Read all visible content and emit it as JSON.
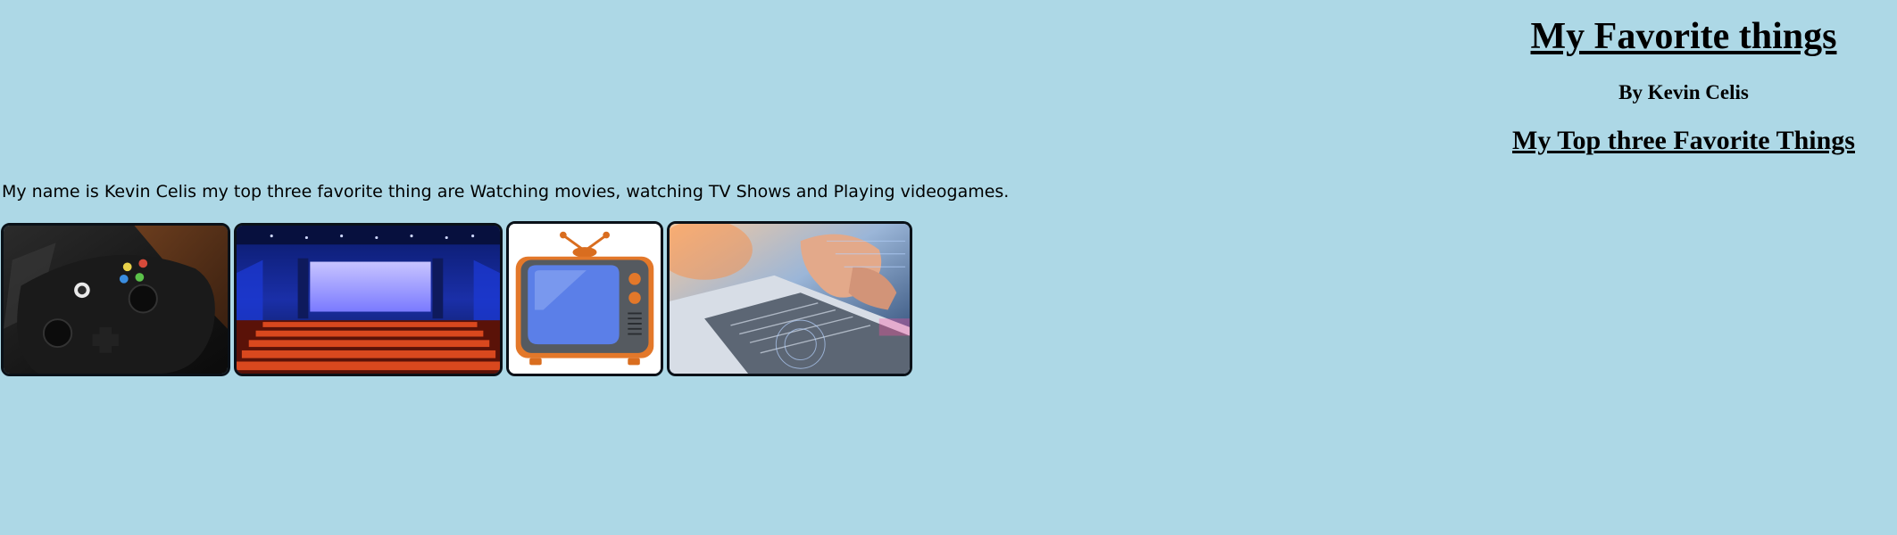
{
  "header": {
    "title": "My Favorite things",
    "byline": "By Kevin Celis",
    "subtitle": "My Top three Favorite Things"
  },
  "intro": "My name is Kevin Celis my top three favorite thing are Watching movies, watching TV Shows and Playing videogames.",
  "gallery": [
    {
      "icon": "game-controller-image"
    },
    {
      "icon": "movie-theater-image"
    },
    {
      "icon": "retro-tv-image"
    },
    {
      "icon": "laptop-typing-image"
    }
  ]
}
